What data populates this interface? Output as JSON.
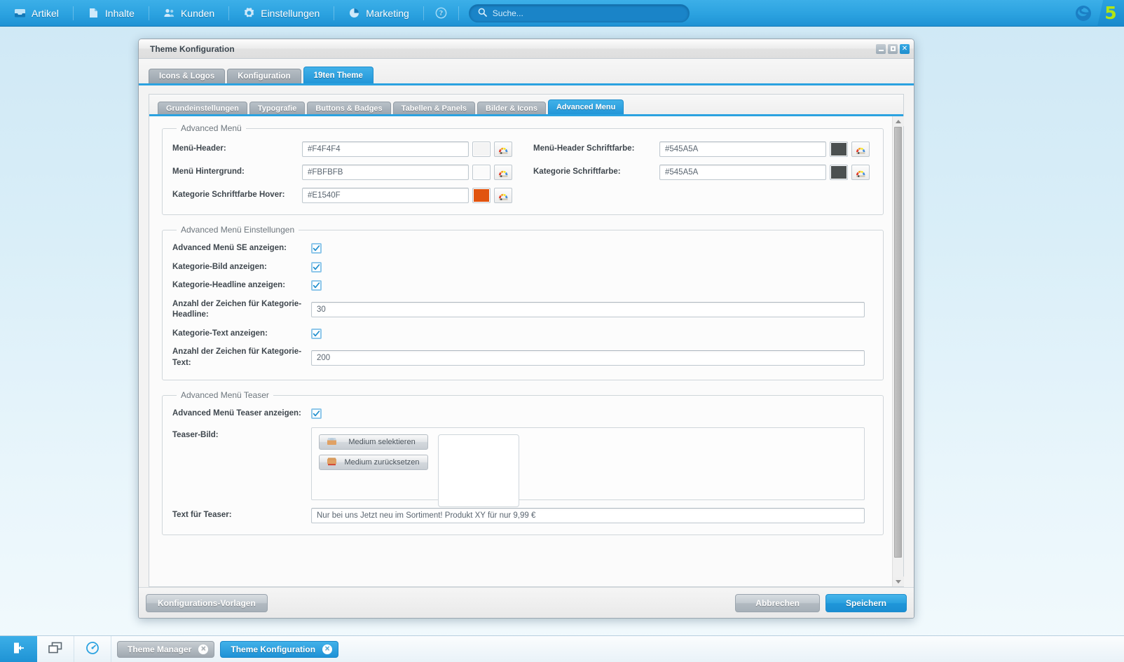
{
  "topnav": {
    "items": [
      {
        "label": "Artikel",
        "icon": "inbox-icon"
      },
      {
        "label": "Inhalte",
        "icon": "document-icon"
      },
      {
        "label": "Kunden",
        "icon": "users-icon"
      },
      {
        "label": "Einstellungen",
        "icon": "gear-icon"
      },
      {
        "label": "Marketing",
        "icon": "pie-chart-icon"
      }
    ],
    "help_icon": "help-icon",
    "search": {
      "placeholder": "Suche...",
      "value": "",
      "icon": "search-icon"
    },
    "logo": {
      "icon": "shopware-logo-icon",
      "version": "5"
    }
  },
  "window": {
    "title": "Theme Konfiguration",
    "controls": {
      "minimize": "–",
      "maximize": "□",
      "close": "✕"
    }
  },
  "outer_tabs": [
    {
      "label": "Icons & Logos",
      "active": false
    },
    {
      "label": "Konfiguration",
      "active": false
    },
    {
      "label": "19ten Theme",
      "active": true
    }
  ],
  "inner_tabs": [
    {
      "label": "Grundeinstellungen",
      "active": false
    },
    {
      "label": "Typografie",
      "active": false
    },
    {
      "label": "Buttons & Badges",
      "active": false
    },
    {
      "label": "Tabellen & Panels",
      "active": false
    },
    {
      "label": "Bilder & Icons",
      "active": false
    },
    {
      "label": "Advanced Menu",
      "active": true
    }
  ],
  "fieldsets": {
    "colors": {
      "legend": "Advanced Menü",
      "rows": [
        {
          "left": {
            "label": "Menü-Header:",
            "value": "#F4F4F4",
            "swatch": "#f4f4f4"
          },
          "right": {
            "label": "Menü-Header Schriftfarbe:",
            "value": "#545A5A",
            "swatch": "#4b5050"
          }
        },
        {
          "left": {
            "label": "Menü Hintergrund:",
            "value": "#FBFBFB",
            "swatch": "#fbfbfb"
          },
          "right": {
            "label": "Kategorie Schriftfarbe:",
            "value": "#545A5A",
            "swatch": "#4b5050"
          }
        },
        {
          "left": {
            "label": "Kategorie Schriftfarbe Hover:",
            "value": "#E1540F",
            "swatch": "#e1540f"
          },
          "right": null
        }
      ]
    },
    "settings": {
      "legend": "Advanced Menü Einstellungen",
      "rows": [
        {
          "type": "checkbox",
          "label": "Advanced Menü SE anzeigen:",
          "checked": true
        },
        {
          "type": "checkbox",
          "label": "Kategorie-Bild anzeigen:",
          "checked": true
        },
        {
          "type": "checkbox",
          "label": "Kategorie-Headline anzeigen:",
          "checked": true
        },
        {
          "type": "text",
          "label": "Anzahl der Zeichen für Kategorie-Headline:",
          "value": "30"
        },
        {
          "type": "checkbox",
          "label": "Kategorie-Text anzeigen:",
          "checked": true
        },
        {
          "type": "text",
          "label": "Anzahl der Zeichen für Kategorie-Text:",
          "value": "200"
        }
      ]
    },
    "teaser": {
      "legend": "Advanced Menü Teaser",
      "show_label": "Advanced Menü Teaser anzeigen:",
      "show_checked": true,
      "image_label": "Teaser-Bild:",
      "select_media_button": "Medium selektieren",
      "reset_media_button": "Medium zurücksetzen",
      "text_label": "Text für Teaser:",
      "text_value": "Nur bei uns Jetzt neu im Sortiment! Produkt XY für nur 9,99 €"
    }
  },
  "footer": {
    "templates_button": "Konfigurations-Vorlagen",
    "cancel_button": "Abbrechen",
    "save_button": "Speichern"
  },
  "taskbar": {
    "logout_icon": "logout-icon",
    "windows_icon": "windows-cascade-icon",
    "performance_icon": "gauge-icon",
    "items": [
      {
        "label": "Theme Manager",
        "active": false,
        "close": "✕"
      },
      {
        "label": "Theme Konfiguration",
        "active": true,
        "close": "✕"
      }
    ]
  },
  "theme_colors": {
    "accent": "#2ba2e0",
    "accent_dark": "#1f8ecd",
    "hover_orange": "#e1540f",
    "logo_green": "#b3e512"
  }
}
